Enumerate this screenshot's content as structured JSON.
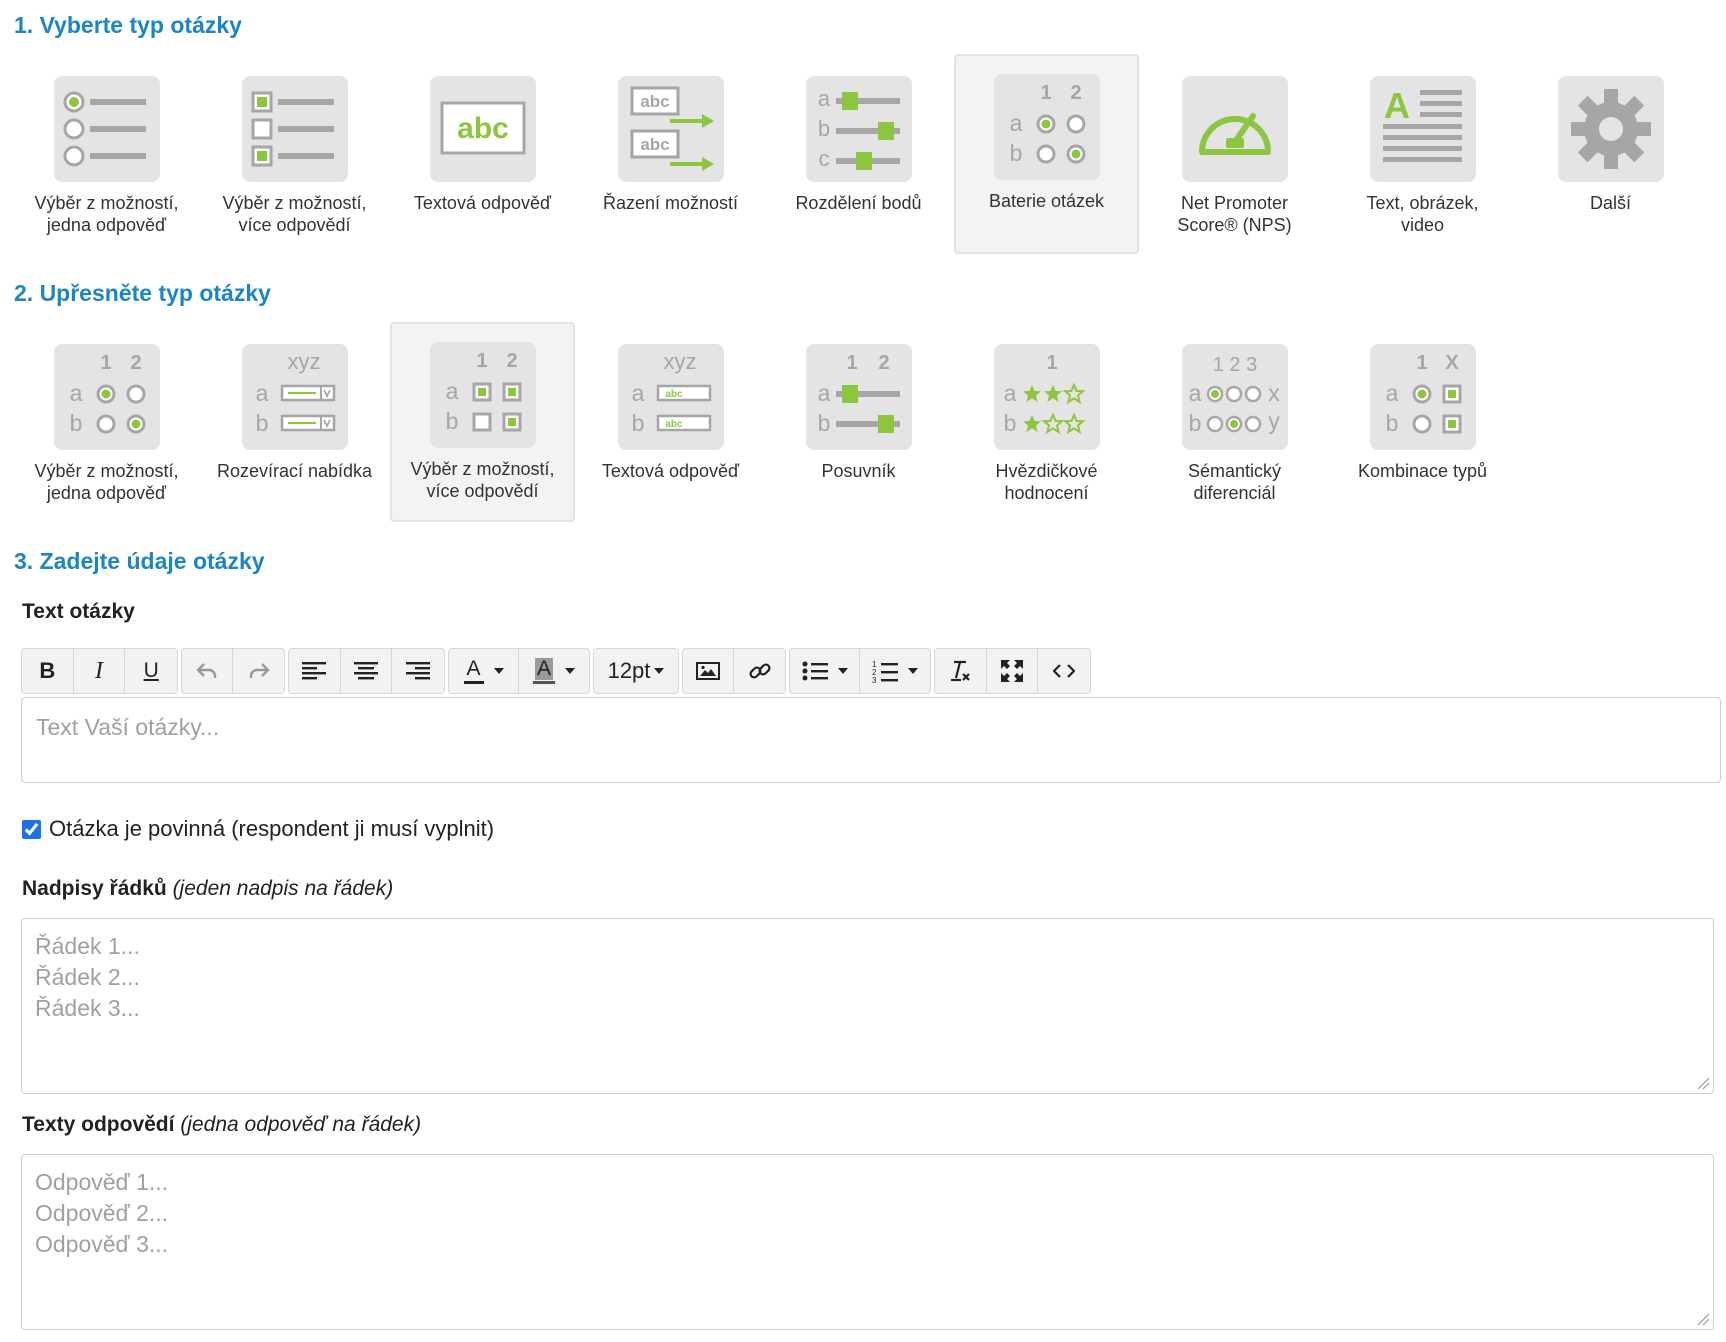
{
  "step1": {
    "title": "1. Vyberte typ otázky",
    "tiles": [
      {
        "label": "Výběr z možností,\njedna odpověď",
        "icon": "single-choice-icon"
      },
      {
        "label": "Výběr z možností,\nvíce odpovědí",
        "icon": "multiple-choice-icon"
      },
      {
        "label": "Textová odpověď",
        "icon": "text-answer-icon",
        "icon_text": "abc"
      },
      {
        "label": "Řazení možností",
        "icon": "ranking-icon",
        "icon_text_1": "abc",
        "icon_text_2": "abc"
      },
      {
        "label": "Rozdělení bodů",
        "icon": "point-distribution-icon",
        "icon_text_1": "a",
        "icon_text_2": "b",
        "icon_text_3": "c"
      },
      {
        "label": "Baterie otázek",
        "icon": "question-battery-icon",
        "selected": true,
        "col_1": "1",
        "col_2": "2",
        "row_1": "a",
        "row_2": "b"
      },
      {
        "label": "Net Promoter\nScore® (NPS)",
        "icon": "nps-gauge-icon"
      },
      {
        "label": "Text, obrázek,\nvideo",
        "icon": "text-image-video-icon",
        "icon_text": "A"
      },
      {
        "label": "Další",
        "icon": "gear-icon"
      }
    ]
  },
  "step2": {
    "title": "2. Upřesněte typ otázky",
    "tiles": [
      {
        "label": "Výběr z možností,\njedna odpověď",
        "icon": "battery-single-choice-icon",
        "col_1": "1",
        "col_2": "2",
        "row_1": "a",
        "row_2": "b"
      },
      {
        "label": "Rozevírací nabídka",
        "icon": "battery-dropdown-icon",
        "head": "xyz",
        "row_1": "a",
        "row_2": "b"
      },
      {
        "label": "Výběr z možností,\nvíce odpovědí",
        "icon": "battery-multiple-choice-icon",
        "selected": true,
        "col_1": "1",
        "col_2": "2",
        "row_1": "a",
        "row_2": "b"
      },
      {
        "label": "Textová odpověď",
        "icon": "battery-text-answer-icon",
        "head": "xyz",
        "row_1": "a",
        "row_2": "b",
        "field_text": "abc"
      },
      {
        "label": "Posuvník",
        "icon": "battery-slider-icon",
        "col_1": "1",
        "col_2": "2",
        "row_1": "a",
        "row_2": "b"
      },
      {
        "label": "Hvězdičkové\nhodnocení",
        "icon": "battery-star-rating-icon",
        "head": "1",
        "row_1": "a",
        "row_2": "b"
      },
      {
        "label": "Sémantický\ndiferenciál",
        "icon": "battery-semantic-differential-icon",
        "head": "1 2 3",
        "row_1": "a",
        "row_2": "b",
        "end_1": "x",
        "end_2": "y"
      },
      {
        "label": "Kombinace typů",
        "icon": "battery-combination-icon",
        "col_1": "1",
        "col_2": "X",
        "row_1": "a",
        "row_2": "b"
      }
    ]
  },
  "step3": {
    "title": "3. Zadejte údaje otázky",
    "question_label": "Text otázky",
    "toolbar": {
      "font_size": "12pt",
      "icons": [
        "bold-icon",
        "italic-icon",
        "underline-icon",
        "undo-icon",
        "redo-icon",
        "align-left-icon",
        "align-center-icon",
        "align-right-icon",
        "text-color-icon",
        "background-color-icon",
        "image-icon",
        "link-icon",
        "bullet-list-icon",
        "numbered-list-icon",
        "clear-formatting-icon",
        "fullscreen-icon",
        "source-code-icon"
      ],
      "bold": "B",
      "italic": "I",
      "underline": "U",
      "text_color": "A",
      "bg_color": "A"
    },
    "question_placeholder": "Text Vaší otázky...",
    "required_checkbox": {
      "label": "Otázka je povinná (respondent ji musí vyplnit)",
      "checked": true
    },
    "rows_label": "Nadpisy řádků",
    "rows_hint": "(jeden nadpis na řádek)",
    "rows_placeholder": [
      "Řádek 1...",
      "Řádek 2...",
      "Řádek 3..."
    ],
    "answers_label": "Texty odpovědí",
    "answers_hint": "(jedna odpověď na řádek)",
    "answers_placeholder": [
      "Odpověď 1...",
      "Odpověď 2...",
      "Odpověď 3..."
    ]
  },
  "colors": {
    "accent_blue": "#1c86c4",
    "icon_green": "#8cc63f",
    "icon_gray": "#a6a6a6",
    "icon_bg": "#e4e4e4"
  }
}
